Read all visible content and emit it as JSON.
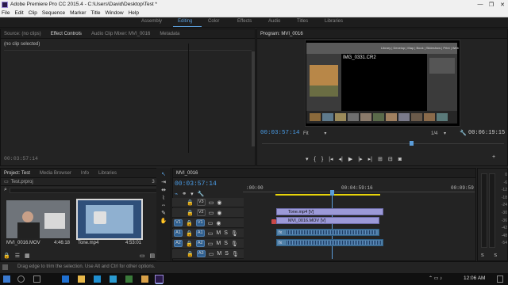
{
  "window": {
    "title": "Adobe Premiere Pro CC 2015.4 - C:\\Users\\David\\Desktop\\Test *",
    "minimize": "—",
    "maximize": "❐",
    "close": "✕"
  },
  "menu": [
    "File",
    "Edit",
    "Clip",
    "Sequence",
    "Marker",
    "Title",
    "Window",
    "Help"
  ],
  "workspaces": {
    "items": [
      "Assembly",
      "Editing",
      "Color",
      "Effects",
      "Audio",
      "Titles",
      "Libraries"
    ],
    "active": "Editing"
  },
  "source_panel": {
    "tabs": [
      "Source: (no clips)",
      "Effect Controls",
      "Audio Clip Mixer: MVI_0016",
      "Metadata"
    ],
    "active_tab": "Effect Controls",
    "clip_selection": "(no clip selected)",
    "timecode": "00:03:57:14"
  },
  "program_panel": {
    "tab": "Program: MVI_0016",
    "timecode": "00:03:57:14",
    "fit": "Fit",
    "fraction": "1/4",
    "duration": "00:06:19:15",
    "inner_screen": {
      "filename": "IMG_0331.CR2",
      "top_menu": "Library | Develop | Map | Book | Slideshow | Print | Web"
    }
  },
  "project_panel": {
    "tabs": [
      "Project: Test",
      "Media Browser",
      "Info",
      "Libraries"
    ],
    "active_tab": "Project: Test",
    "project_file": "Test.prproj",
    "item_count": "3 Items",
    "items": [
      {
        "name": "MVI_0016.MOV",
        "duration": "4:46:18"
      },
      {
        "name": "Tone.mp4",
        "duration": "4:53:01"
      }
    ]
  },
  "timeline": {
    "tab": "MVI_0016",
    "timecode": "00:03:57:14",
    "ruler": [
      ":00:00",
      "00:04:59:16",
      "00:09:59"
    ],
    "tracks": [
      {
        "label": "V3",
        "type": "video"
      },
      {
        "label": "V2",
        "type": "video"
      },
      {
        "label": "V1",
        "type": "video",
        "source": "V1"
      },
      {
        "label": "A1",
        "type": "audio",
        "source": "A1"
      },
      {
        "label": "A2",
        "type": "audio",
        "source": "A2"
      },
      {
        "label": "A3",
        "type": "audio"
      }
    ],
    "clips": {
      "v2": "Tone.mp4 [V]",
      "v1": "MVI_0016.MOV [V]",
      "a_marker": "fx"
    },
    "mute": "M",
    "solo": "S"
  },
  "audio_meter": {
    "labels": [
      "0",
      "-6",
      "-12",
      "-18",
      "-24",
      "-30",
      "-36",
      "-42",
      "-48",
      "-54"
    ],
    "bottom": [
      "S",
      "S"
    ]
  },
  "status": {
    "message": "Drag edge to trim the selection. Use Alt and Ctrl for other options."
  },
  "taskbar": {
    "time": "12:06 AM"
  },
  "colors": {
    "accent": "#5b9dd9",
    "playhead": "#5b9dd9",
    "timecode": "#4a9de8",
    "video_clip": "#9c9ad8",
    "audio_clip": "#4f7fa6",
    "work_area": "#e8d40a"
  }
}
